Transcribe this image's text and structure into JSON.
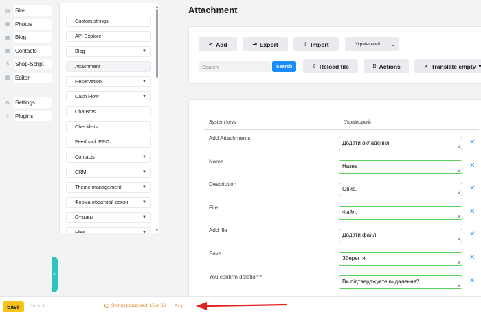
{
  "app_nav": [
    {
      "icon": "file-icon",
      "glyph": "▤",
      "label": "Site"
    },
    {
      "icon": "grid-icon",
      "glyph": "▦",
      "label": "Photos"
    },
    {
      "icon": "grid-icon",
      "glyph": "▦",
      "label": "Blog"
    },
    {
      "icon": "grid-icon",
      "glyph": "▦",
      "label": "Contacts"
    },
    {
      "icon": "dollar-icon",
      "glyph": "$",
      "label": "Shop-Script"
    },
    {
      "icon": "grid-icon",
      "glyph": "▦",
      "label": "Editor"
    },
    {
      "icon": "gear-icon",
      "glyph": "⚙",
      "label": "Settings"
    },
    {
      "icon": "plug-icon",
      "glyph": "⏚",
      "label": "Plugins"
    }
  ],
  "plugins": [
    {
      "label": "Custom strings",
      "dropdown": false
    },
    {
      "label": "API Explorer",
      "dropdown": false
    },
    {
      "label": "Blog",
      "dropdown": true
    },
    {
      "label": "Attachment",
      "dropdown": false,
      "active": true
    },
    {
      "label": "Reservation",
      "dropdown": true
    },
    {
      "label": "Cash Flow",
      "dropdown": true
    },
    {
      "label": "ChatBots",
      "dropdown": false
    },
    {
      "label": "Checklists",
      "dropdown": false
    },
    {
      "label": "Feedback PRO",
      "dropdown": false
    },
    {
      "label": "Contacts",
      "dropdown": true
    },
    {
      "label": "CRM",
      "dropdown": true
    },
    {
      "label": "Theme management",
      "dropdown": true
    },
    {
      "label": "Форма обратной связи",
      "dropdown": true
    },
    {
      "label": "Отзывы",
      "dropdown": true
    },
    {
      "label": "Files",
      "dropdown": true
    }
  ],
  "page": {
    "title": "Attachment"
  },
  "toolbar": {
    "add_label": "Add",
    "export_label": "Export",
    "import_label": "Import",
    "language_selected": "Український",
    "search_placeholder": "Search",
    "search_button": "Search",
    "reload_label": "Reload file",
    "actions_label": "Actions",
    "translate_label": "Translate empty"
  },
  "table": {
    "col_keys": "System keys",
    "col_lang": "Український",
    "rows": [
      {
        "key": "Add Attachments",
        "value": "Додати вкладення."
      },
      {
        "key": "Name",
        "value": "Назва"
      },
      {
        "key": "Description",
        "value": "Опис."
      },
      {
        "key": "File",
        "value": "Файл."
      },
      {
        "key": "Add file",
        "value": "Додати файл."
      },
      {
        "key": "Save",
        "value": "Зберегти."
      },
      {
        "key": "You confirm deletion?",
        "value": "Ви підтверджуєте видалення?"
      }
    ]
  },
  "footer": {
    "save_label": "Save",
    "shortcut_hint": "Ctrl + S",
    "progress_text": "Strings processed: 15 of 68",
    "stop_label": "Stop"
  },
  "colors": {
    "accent_blue": "#1a8cff",
    "save_yellow": "#f7c31b",
    "progress_orange": "#e67e22",
    "valid_green": "#5ad35a",
    "arrow_red": "#e02424",
    "toggle_teal": "#2ec4c0"
  }
}
